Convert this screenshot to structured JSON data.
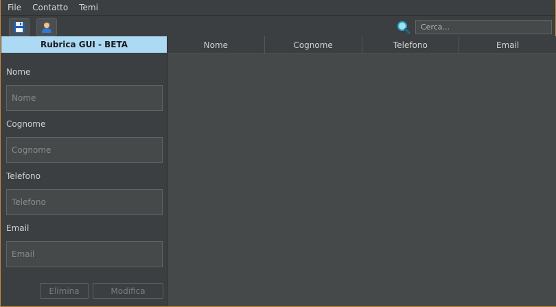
{
  "menu": [
    "File",
    "Contatto",
    "Temi"
  ],
  "toolbar": {
    "save_icon": "floppy-disk-icon",
    "contact_icon": "user-icon"
  },
  "search": {
    "placeholder": "Cerca..."
  },
  "form": {
    "title": "Rubrica GUI - BETA",
    "fields": [
      {
        "label": "Nome",
        "placeholder": "Nome"
      },
      {
        "label": "Cognome",
        "placeholder": "Cognome"
      },
      {
        "label": "Telefono",
        "placeholder": "Telefono"
      },
      {
        "label": "Email",
        "placeholder": "Email"
      }
    ],
    "delete_label": "Elimina",
    "edit_label": "Modifica"
  },
  "table": {
    "columns": [
      "Nome",
      "Cognome",
      "Telefono",
      "Email"
    ],
    "rows": []
  },
  "colors": {
    "title_bg": "#acd9f4",
    "window_border": "#c9893a",
    "background": "#3c3f41"
  }
}
